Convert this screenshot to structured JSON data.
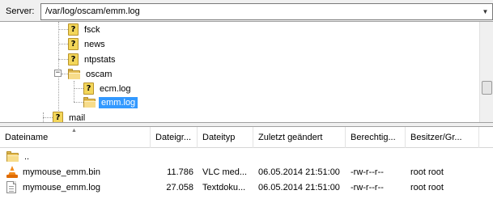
{
  "server_bar": {
    "label": "Server:",
    "path": "/var/log/oscam/emm.log",
    "dropdown_icon": "chevron-down-icon"
  },
  "tree": {
    "items": [
      {
        "label": "fsck",
        "icon": "unknown-file-icon"
      },
      {
        "label": "news",
        "icon": "unknown-file-icon"
      },
      {
        "label": "ntpstats",
        "icon": "unknown-file-icon"
      },
      {
        "label": "oscam",
        "icon": "folder-icon",
        "expanded": true
      },
      {
        "label": "ecm.log",
        "icon": "unknown-file-icon"
      },
      {
        "label": "emm.log",
        "icon": "folder-icon",
        "selected": true
      },
      {
        "label": "mail",
        "icon": "unknown-file-icon"
      }
    ],
    "expander_symbol": "−",
    "selection_color": "#3399ff"
  },
  "file_list": {
    "columns": [
      "Dateiname",
      "Dateigr...",
      "Dateityp",
      "Zuletzt geändert",
      "Berechtig...",
      "Besitzer/Gr..."
    ],
    "sorted_column": "Dateiname",
    "rows": [
      {
        "name": "..",
        "size": "",
        "type": "",
        "modified": "",
        "perms": "",
        "owner": "",
        "icon": "folder-icon"
      },
      {
        "name": "mymouse_emm.bin",
        "size": "11.786",
        "type": "VLC med...",
        "modified": "06.05.2014 21:51:00",
        "perms": "-rw-r--r--",
        "owner": "root root",
        "icon": "vlc-icon"
      },
      {
        "name": "mymouse_emm.log",
        "size": "27.058",
        "type": "Textdoku...",
        "modified": "06.05.2014 21:51:00",
        "perms": "-rw-r--r--",
        "owner": "root root",
        "icon": "text-document-icon"
      }
    ]
  }
}
